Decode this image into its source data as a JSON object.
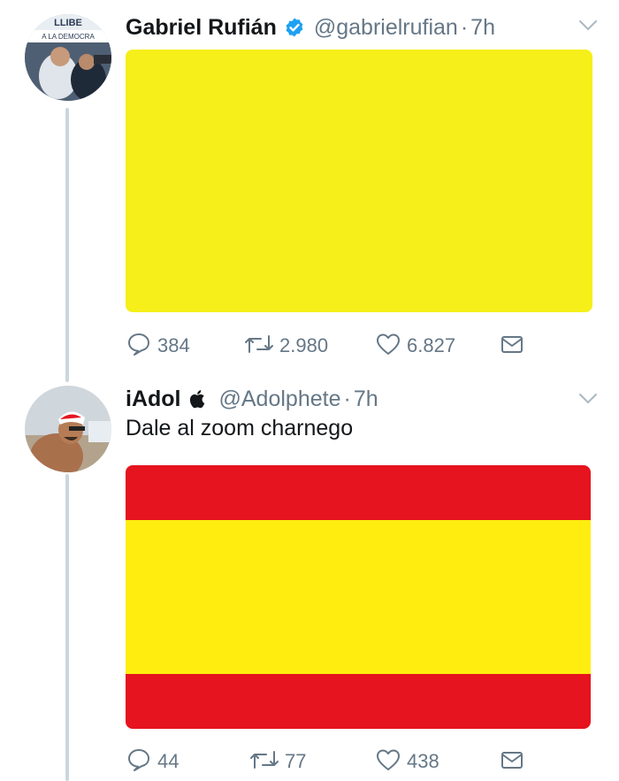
{
  "tweets": [
    {
      "name": "Gabriel Rufián",
      "handle": "@gabrielrufian",
      "separator": "·",
      "time": "7h",
      "verified": true,
      "avatar_sign_text": "LLIBE",
      "avatar_banner_text": "A LA DEMOCRA",
      "text": "",
      "media": {
        "type": "flag",
        "stripes": [
          "#f6ef1a"
        ]
      },
      "actions": {
        "replies": "384",
        "retweets": "2.980",
        "likes": "6.827"
      }
    },
    {
      "name": "iAdol",
      "name_glyph": "apple-icon",
      "handle": "@Adolphete",
      "separator": "·",
      "time": "7h",
      "verified": false,
      "text": "Dale al zoom charnego",
      "media": {
        "type": "flag",
        "stripes": [
          "#e5141f",
          "#ffed0f",
          "#e5141f"
        ]
      },
      "actions": {
        "replies": "44",
        "retweets": "77",
        "likes": "438"
      }
    }
  ],
  "icons": {
    "reply": "reply-icon",
    "retweet": "retweet-icon",
    "like": "heart-icon",
    "dm": "envelope-icon",
    "more": "chevron-down-icon",
    "verified": "verified-badge-icon"
  },
  "colors": {
    "text": "#14171a",
    "secondary": "#657786",
    "verified": "#1da1f2",
    "thread_line": "#ccd6dd"
  }
}
